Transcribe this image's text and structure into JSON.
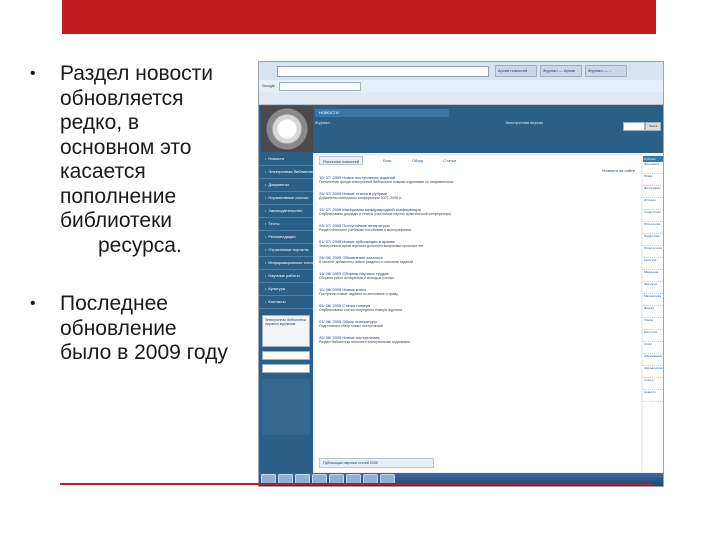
{
  "slide": {
    "bullets": [
      {
        "lines": [
          "Раздел новости",
          "обновляется",
          "редко, в",
          "основном это",
          "касается",
          "пополнение",
          "библиотеки"
        ],
        "indent_line": "ресурса."
      },
      {
        "lines": [
          "Последнее",
          "обновление",
          "было в 2009 году"
        ],
        "indent_line": ""
      }
    ],
    "accent_color": "#c0191e"
  },
  "browser": {
    "tabs": [
      "Архив новостей",
      "Журнал — Архив",
      "Журнал — ..."
    ],
    "search_engine": "Google"
  },
  "site": {
    "header_title": "НОВОСТИ",
    "header_sub1": "Журнал",
    "header_sub2": "Электронная версия",
    "search_button": "Поиск",
    "left_nav": [
      "Новости",
      "Электронная библиотека",
      "Документы",
      "Нормативные ссылки",
      "Законодательство",
      "Тесты",
      "Рекомендации",
      "Отраслевые порталы",
      "Информационные технологии",
      "Научные работы",
      "Культура",
      "Контакты"
    ],
    "nav_block_text": "Электронная библиотека научных журналов",
    "main_tabs": [
      "Рассылки новостей",
      "Блог",
      "Обзор",
      "Статьи"
    ],
    "main_title": "Новости на сайте",
    "news": [
      {
        "head": "10/ 07/ 2009 Новое поступление изданий",
        "text": "Пополнение фонда электронной библиотеки новыми изданиями по направлениям"
      },
      {
        "head": "29/ 07/ 2009 Новые статьи в рубрике",
        "text": "Добавлены материалы конференции 2007–2008 гг."
      },
      {
        "head": "15/ 07/ 2009 Материалы международной конференции",
        "text": "Опубликованы доклады и тезисы участников научно-практической конференции"
      },
      {
        "head": "03/ 07/ 2009 Поступление литературы",
        "text": "Раздел пополнен учебными пособиями и монографиями"
      },
      {
        "head": "01/ 07/ 2009 Новые публикации в архиве",
        "text": "Электронный архив журнала дополнен выпусками прошлых лет"
      },
      {
        "head": "25/ 06/ 2009 Обновление каталога",
        "text": "В каталог добавлены новые разделы и описания изданий"
      },
      {
        "head": "19/ 06/ 2009 Сборник научных трудов",
        "text": "Сборник работ аспирантов и молодых ученых"
      },
      {
        "head": "10/ 06/ 2009 Новые книги",
        "text": "Поступили новые издания по экономике и праву"
      },
      {
        "head": "05/ 06/ 2009 Статьи номера",
        "text": "Опубликованы статьи очередного номера журнала"
      },
      {
        "head": "01/ 06/ 2009 Обзор литературы",
        "text": "Подготовлен обзор новых поступлений"
      },
      {
        "head": "25/ 05/ 2009 Новые поступления",
        "text": "Раздел библиотеки пополнен электронными изданиями"
      }
    ],
    "news_footer": "Публикации научных статей 2009",
    "right_head": "Рубрики",
    "right_items": [
      "Экономика",
      "Право",
      "Философия",
      "История",
      "Социология",
      "Психология",
      "Педагогика",
      "Политология",
      "Культура",
      "Медицина",
      "Экология",
      "Математика",
      "Физика",
      "Химия",
      "Биология",
      "Спорт",
      "Образование",
      "Журналистика",
      "Статьи",
      "Новости"
    ]
  }
}
